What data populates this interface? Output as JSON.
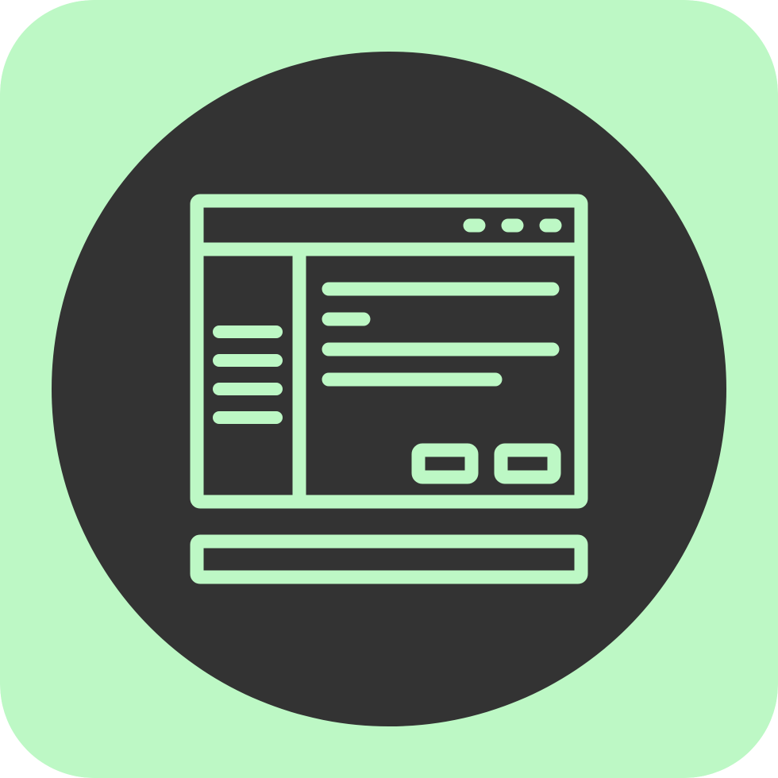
{
  "icon": {
    "name": "browser-window-icon",
    "colors": {
      "tile_background": "#bdf8c5",
      "circle_fill": "#333333",
      "line_color": "#bdf8c5"
    },
    "parts": [
      "title-bar",
      "window-control-dots",
      "sidebar",
      "sidebar-menu-lines",
      "content-text-lines",
      "dialog-buttons",
      "bottom-status-bar"
    ]
  }
}
